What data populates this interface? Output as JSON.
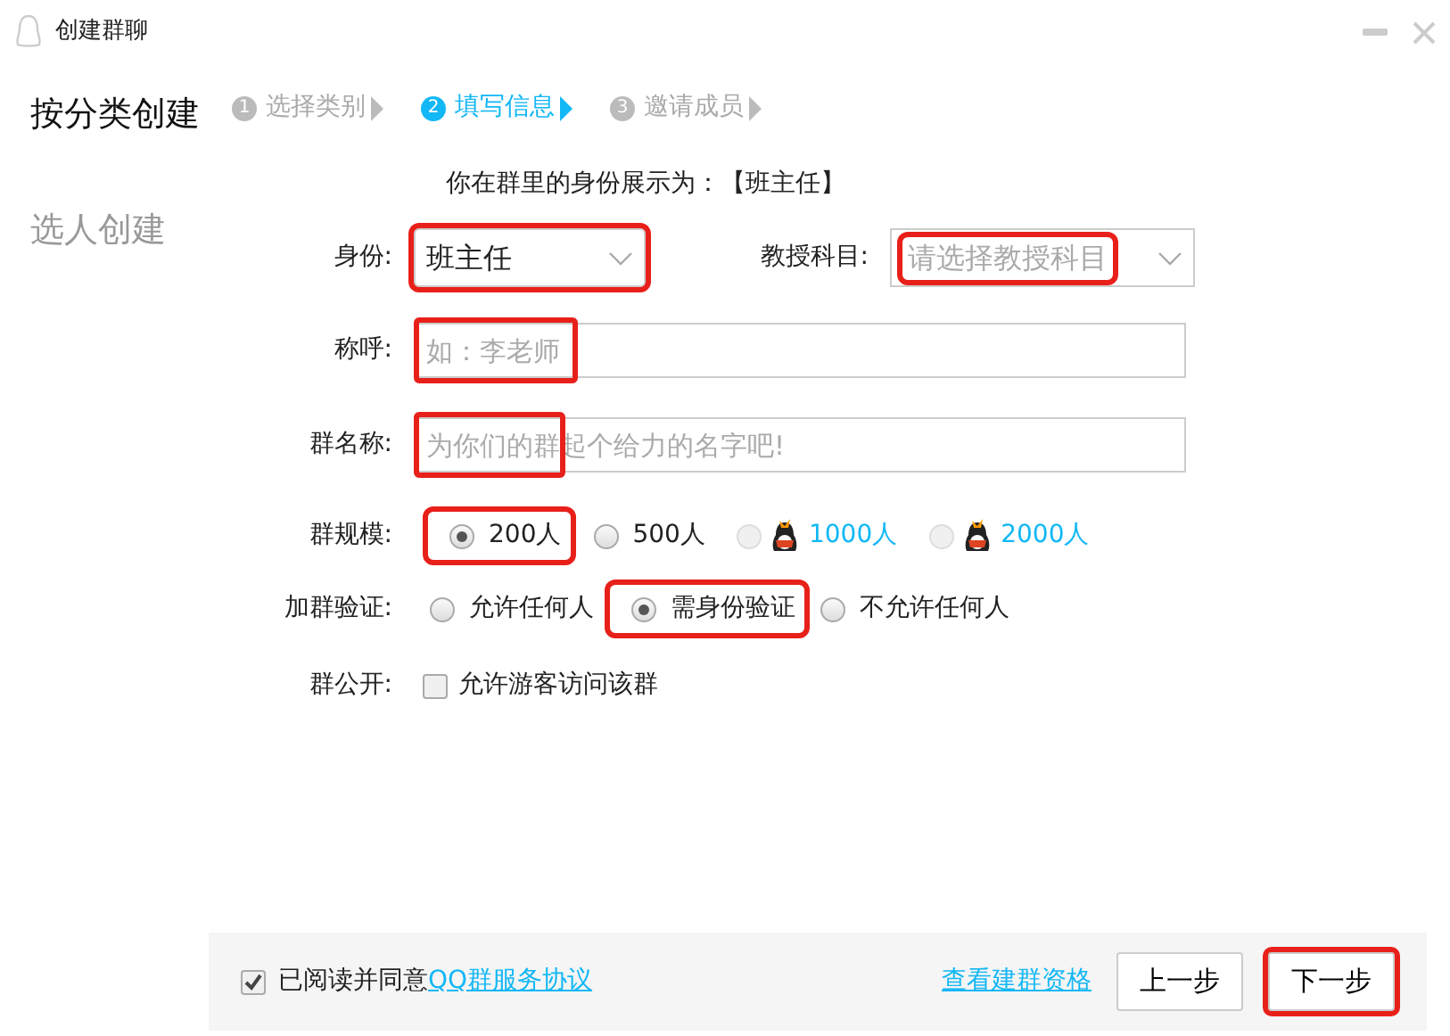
{
  "window": {
    "title": "创建群聊"
  },
  "sidebar": {
    "items": [
      {
        "label": "按分类创建",
        "selected": true
      },
      {
        "label": "选人创建",
        "selected": false
      }
    ]
  },
  "steps": [
    {
      "number": "1",
      "label": "选择类别",
      "selected": false
    },
    {
      "number": "2",
      "label": "填写信息",
      "selected": true
    },
    {
      "number": "3",
      "label": "邀请成员",
      "selected": false
    }
  ],
  "identity_preview": "你在群里的身份展示为：【班主任】",
  "form": {
    "identity": {
      "label": "身份:",
      "value": "班主任",
      "highlighted": true
    },
    "subject": {
      "label": "教授科目:",
      "placeholder": "请选择教授科目",
      "highlighted": true
    },
    "nickname": {
      "label": "称呼:",
      "placeholder": "如：李老师",
      "highlighted": true
    },
    "group_name": {
      "label": "群名称:",
      "placeholder": "为你们的群起个给力的名字吧!",
      "highlighted": true
    },
    "group_size": {
      "label": "群规模:",
      "options": [
        {
          "label": "200人",
          "selected": true,
          "disabled": false,
          "premium": false,
          "highlighted": true
        },
        {
          "label": "500人",
          "selected": false,
          "disabled": false,
          "premium": false,
          "highlighted": false
        },
        {
          "label": "1000人",
          "selected": false,
          "disabled": true,
          "premium": true,
          "highlighted": false
        },
        {
          "label": "2000人",
          "selected": false,
          "disabled": true,
          "premium": true,
          "highlighted": false
        }
      ]
    },
    "join_verification": {
      "label": "加群验证:",
      "options": [
        {
          "label": "允许任何人",
          "selected": false,
          "highlighted": false
        },
        {
          "label": "需身份验证",
          "selected": true,
          "highlighted": true
        },
        {
          "label": "不允许任何人",
          "selected": false,
          "highlighted": false
        }
      ]
    },
    "public": {
      "label": "群公开:",
      "checkbox": {
        "label": "允许游客访问该群",
        "checked": false
      }
    }
  },
  "footer": {
    "agree": {
      "checked": true,
      "text": "已阅读并同意",
      "link": "QQ群服务协议"
    },
    "qualification_link": "查看建群资格",
    "buttons": [
      {
        "label": "上一步",
        "highlighted": false
      },
      {
        "label": "下一步",
        "highlighted": true
      }
    ]
  }
}
